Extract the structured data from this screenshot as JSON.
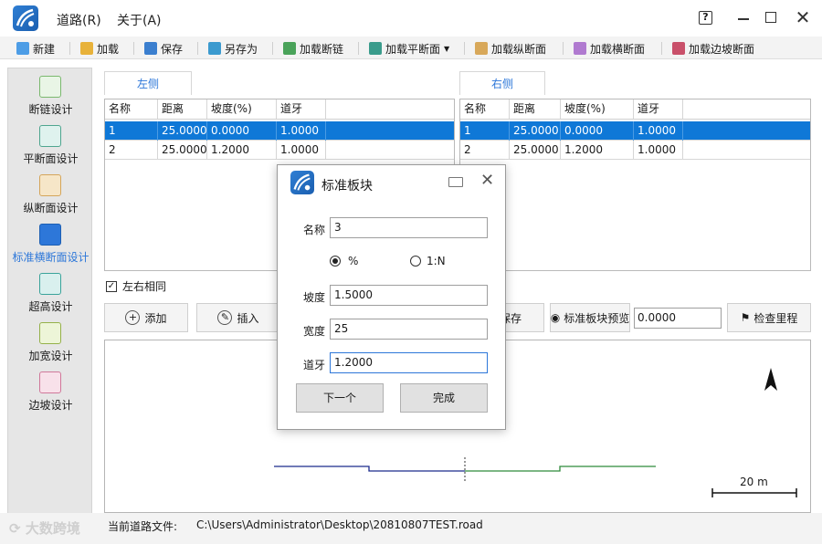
{
  "menu": {
    "road": "道路(R)",
    "about": "关于(A)"
  },
  "window": {
    "help": "?",
    "close": "✕"
  },
  "toolbar": {
    "new": "新建",
    "load": "加载",
    "save": "保存",
    "save_as": "另存为",
    "load_chain": "加载断链",
    "load_plane": "加载平断面",
    "load_profile": "加载纵断面",
    "load_cross": "加载横断面",
    "load_slope": "加载边坡断面"
  },
  "sidebar": {
    "items": [
      {
        "label": "断链设计"
      },
      {
        "label": "平断面设计"
      },
      {
        "label": "纵断面设计"
      },
      {
        "label": "标准横断面设计"
      },
      {
        "label": "超高设计"
      },
      {
        "label": "加宽设计"
      },
      {
        "label": "边坡设计"
      }
    ]
  },
  "left_panel": {
    "tab": "左侧",
    "columns": [
      "名称",
      "距离",
      "坡度(%)",
      "道牙"
    ],
    "rows": [
      [
        "1",
        "25.0000",
        "0.0000",
        "1.0000"
      ],
      [
        "2",
        "25.0000",
        "1.2000",
        "1.0000"
      ]
    ]
  },
  "right_panel": {
    "tab": "右侧",
    "columns": [
      "名称",
      "距离",
      "坡度(%)",
      "道牙"
    ],
    "rows": [
      [
        "1",
        "25.0000",
        "0.0000",
        "1.0000"
      ],
      [
        "2",
        "25.0000",
        "1.2000",
        "1.0000"
      ]
    ]
  },
  "controls": {
    "same_lr": "左右相同",
    "add": "添加",
    "insert": "插入",
    "save_partial": "保存",
    "preview": "标准板块预览",
    "preview_value": "0.0000",
    "check_mileage": "检查里程"
  },
  "canvas": {
    "scale_label": "20 m",
    "north": "N"
  },
  "dialog": {
    "title": "标准板块",
    "name_label": "名称",
    "name_value": "3",
    "option_percent": "%",
    "option_ratio": "1:N",
    "slope_label": "坡度",
    "slope_value": "1.5000",
    "width_label": "宽度",
    "width_value": "25",
    "curb_label": "道牙",
    "curb_value": "1.2000",
    "next": "下一个",
    "finish": "完成"
  },
  "status": {
    "label": "当前道路文件:",
    "path": "C:\\Users\\Administrator\\Desktop\\20810807TEST.road"
  },
  "watermark": "大数跨境",
  "colors": {
    "accent": "#2d77d9",
    "selection": "#0f78d7",
    "left_line": "#1b2a8c",
    "right_line": "#2e8a3a"
  }
}
